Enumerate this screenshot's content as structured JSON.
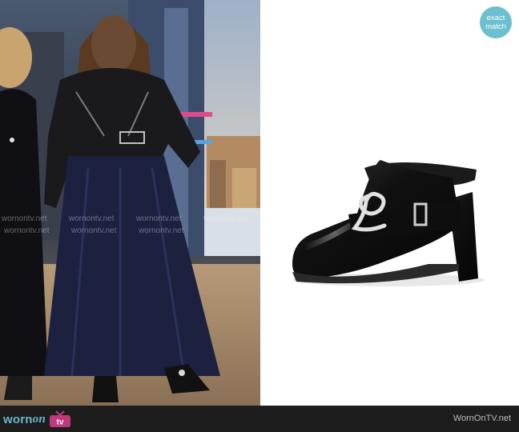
{
  "badge": {
    "line1": "exact",
    "line2": "match"
  },
  "footer": {
    "logo_word": "worn",
    "logo_on": "on",
    "logo_tv": "tv",
    "site": "WornOnTV.net"
  },
  "watermarks": [
    {
      "text": "wornontv.net"
    },
    {
      "text": "wornontv.net"
    },
    {
      "text": "wornontv.net"
    },
    {
      "text": "wornontv.net"
    },
    {
      "text": "wornontv.net"
    },
    {
      "text": "wornontv.net"
    },
    {
      "text": "wornontv.net"
    }
  ],
  "colors": {
    "accent": "#6cbfce",
    "footer_bg": "#1d1d1d",
    "logo_tv": "#c0397a"
  },
  "images": {
    "left": "tv-host-wearing-leather-jacket-and-tulle-skirt",
    "right": "black-leather-buckle-mule-product-shot"
  }
}
